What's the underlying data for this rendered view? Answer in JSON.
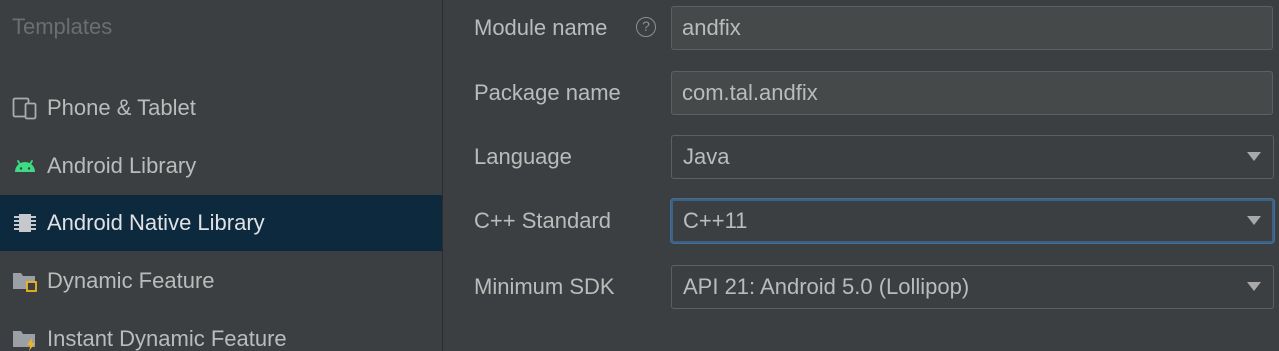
{
  "sidebar": {
    "header": "Templates",
    "items": [
      {
        "label": "Phone & Tablet",
        "icon": "phone-tablet-icon"
      },
      {
        "label": "Android Library",
        "icon": "android-icon"
      },
      {
        "label": "Android Native Library",
        "icon": "native-library-icon",
        "selected": true
      },
      {
        "label": "Dynamic Feature",
        "icon": "dynamic-feature-folder-icon"
      },
      {
        "label": "Instant Dynamic Feature",
        "icon": "instant-dynamic-feature-icon"
      }
    ]
  },
  "form": {
    "module_name": {
      "label": "Module name",
      "value": "andfix",
      "help": "?"
    },
    "package_name": {
      "label": "Package name",
      "value": "com.tal.andfix"
    },
    "language": {
      "label": "Language",
      "value": "Java"
    },
    "cpp_standard": {
      "label": "C++ Standard",
      "value": "C++11"
    },
    "minimum_sdk": {
      "label": "Minimum SDK",
      "value": "API 21: Android 5.0 (Lollipop)"
    }
  },
  "colors": {
    "background": "#3c3f41",
    "selected_row": "#0d293e",
    "focus_border": "#3d6185",
    "android_green": "#3ddc84",
    "folder_gray": "#9aa0a6",
    "badge_yellow": "#f2b51f"
  }
}
